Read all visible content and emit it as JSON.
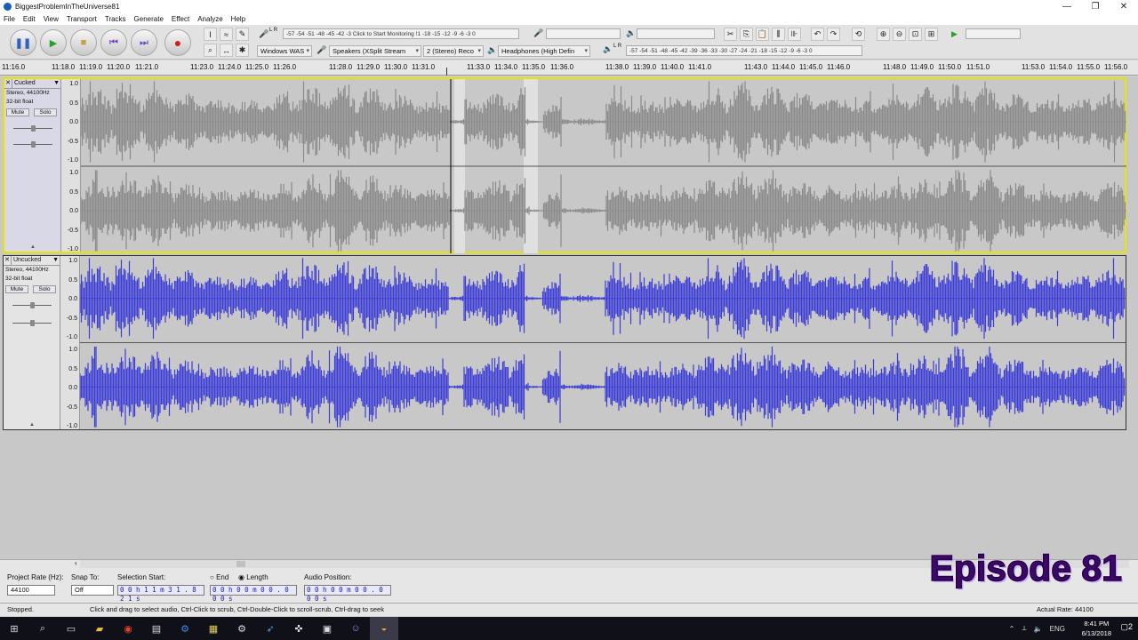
{
  "window": {
    "title": "BiggestProblemInTheUniverse81",
    "minimize": "—",
    "maximize": "❐",
    "close": "✕"
  },
  "menu": [
    "File",
    "Edit",
    "View",
    "Transport",
    "Tracks",
    "Generate",
    "Effect",
    "Analyze",
    "Help"
  ],
  "transport": {
    "pause_icon": "pause-icon",
    "play_icon": "play-icon",
    "stop_icon": "stop-icon",
    "skip_start_icon": "skip-start-icon",
    "skip_end_icon": "skip-end-icon",
    "record_icon": "record-icon",
    "play_color": "#2aa02a",
    "record_color": "#cc2222"
  },
  "meters": {
    "record_meter": "-57 -54 -51 -48 -45 -42 -3 Click to Start Monitoring !1 -18 -15 -12 -9 -6 -3 0",
    "playback_meter": "-57 -54 -51 -48 -45 -42 -39 -36 -33 -30 -27 -24 -21 -18 -15 -12 -9 -6 -3 0",
    "rec_label": "L R",
    "play_label": "L R"
  },
  "devices": {
    "host": "Windows WAS",
    "recording_device": "Speakers (XSplit Stream",
    "recording_channels": "2 (Stereo) Reco",
    "playback_device": "Headphones (High Defin"
  },
  "ruler": {
    "labels": [
      "11:16.0",
      "11:18.0",
      "11:19.0",
      "11:20.0",
      "11:21.0",
      "11:23.0",
      "11:24.0",
      "11:25.0",
      "11:26.0",
      "11:28.0",
      "11:29.0",
      "11:30.0",
      "11:31.0",
      "11:33.0",
      "11:34.0",
      "11:35.0",
      "11:36.0",
      "11:38.0",
      "11:39.0",
      "11:40.0",
      "11:41.0",
      "11:43.0",
      "11:44.0",
      "11:45.0",
      "11:46.0",
      "11:48.0",
      "11:49.0",
      "11:50.0",
      "11:51.0",
      "11:53.0",
      "11:54.0",
      "11:55.0",
      "11:56.0"
    ]
  },
  "tracks": [
    {
      "name": "Cucked",
      "format": "Stereo, 44100Hz",
      "bitdepth": "32-bit float",
      "mute": "Mute",
      "solo": "Solo",
      "scale": [
        "1.0",
        "0.5",
        "0.0",
        "-0.5",
        "-1.0"
      ],
      "wave_color": "#8a8a8a",
      "selected": true
    },
    {
      "name": "Uncucked",
      "format": "Stereo, 44100Hz",
      "bitdepth": "32-bit float",
      "mute": "Mute",
      "solo": "Solo",
      "scale": [
        "1.0",
        "0.5",
        "0.0",
        "-0.5",
        "-1.0"
      ],
      "wave_color": "#3c3cd6",
      "selected": false
    }
  ],
  "selection_bar": {
    "project_rate_label": "Project Rate (Hz):",
    "project_rate": "44100",
    "snap_label": "Snap To:",
    "snap_value": "Off",
    "selection_start_label": "Selection Start:",
    "selection_start": "0 0 h 1 1 m 3 1 . 8 2 1 s",
    "end_label": "End",
    "length_label": "Length",
    "length_value": "0 0 h 0 0 m 0 0 . 0 0 0 s",
    "audio_position_label": "Audio Position:",
    "audio_position": "0 0 h 0 0 m 0 0 . 0 0 0 s"
  },
  "overlay": {
    "episode": "Episode 81"
  },
  "status": {
    "state": "Stopped.",
    "hint": "Click and drag to select audio, Ctrl-Click to scrub, Ctrl-Double-Click to scroll-scrub, Ctrl-drag to seek",
    "actual_rate": "Actual Rate: 44100"
  },
  "taskbar": {
    "lang": "ENG",
    "time": "8:41 PM",
    "date": "6/13/2018",
    "notif": "2"
  }
}
